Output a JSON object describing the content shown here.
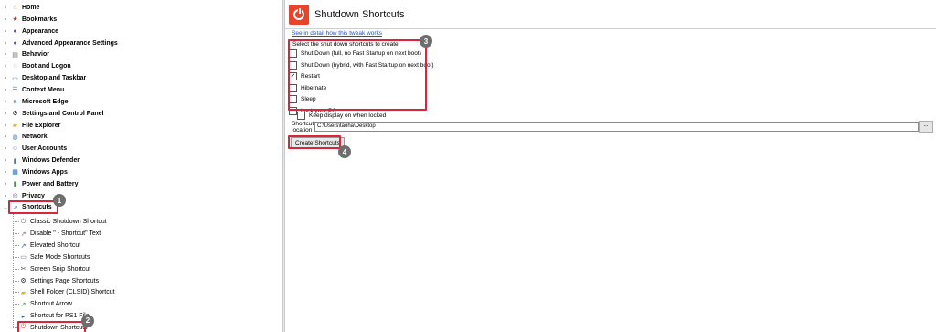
{
  "tree": {
    "categories": [
      {
        "label": "Home",
        "icon": "home-icon",
        "glyph": "⌂",
        "color": "#d8a339",
        "arrow": "›"
      },
      {
        "label": "Bookmarks",
        "icon": "bookmark-icon",
        "glyph": "★",
        "color": "#c0392b",
        "arrow": "›"
      },
      {
        "label": "Appearance",
        "icon": "palette-icon",
        "glyph": "●",
        "color": "#7b3fbf",
        "arrow": "›"
      },
      {
        "label": "Advanced Appearance Settings",
        "icon": "advanced-appearance-icon",
        "glyph": "●",
        "color": "#4a55c8",
        "arrow": "›"
      },
      {
        "label": "Behavior",
        "icon": "behavior-icon",
        "glyph": "▤",
        "color": "#6d6d6d",
        "arrow": "›"
      },
      {
        "label": "Boot and Logon",
        "icon": "boot-icon",
        "glyph": "◌",
        "color": "#555555",
        "arrow": "›"
      },
      {
        "label": "Desktop and Taskbar",
        "icon": "desktop-icon",
        "glyph": "▭",
        "color": "#3b7bd4",
        "arrow": "›"
      },
      {
        "label": "Context Menu",
        "icon": "context-menu-icon",
        "glyph": "☰",
        "color": "#5b6c8c",
        "arrow": "›"
      },
      {
        "label": "Microsoft Edge",
        "icon": "edge-icon",
        "glyph": "e",
        "color": "#1f8ec9",
        "arrow": "›"
      },
      {
        "label": "Settings and Control Panel",
        "icon": "settings-icon",
        "glyph": "⚙",
        "color": "#222222",
        "arrow": "›"
      },
      {
        "label": "File Explorer",
        "icon": "folder-icon",
        "glyph": "▰",
        "color": "#e3b23c",
        "arrow": "›"
      },
      {
        "label": "Network",
        "icon": "network-icon",
        "glyph": "◍",
        "color": "#3b6fb6",
        "arrow": "›"
      },
      {
        "label": "User Accounts",
        "icon": "user-icon",
        "glyph": "☺",
        "color": "#3a7abf",
        "arrow": "›"
      },
      {
        "label": "Windows Defender",
        "icon": "defender-icon",
        "glyph": "▮",
        "color": "#4b6ea8",
        "arrow": "›"
      },
      {
        "label": "Windows Apps",
        "icon": "apps-icon",
        "glyph": "▦",
        "color": "#2a6cc2",
        "arrow": "›"
      },
      {
        "label": "Power and Battery",
        "icon": "battery-icon",
        "glyph": "▮",
        "color": "#3c9a3c",
        "arrow": "›"
      },
      {
        "label": "Privacy",
        "icon": "privacy-icon",
        "glyph": "◎",
        "color": "#5b5b8c",
        "arrow": "›"
      },
      {
        "label": "Shortcuts",
        "icon": "shortcuts-icon",
        "glyph": "↗",
        "color": "#2a5bc0",
        "arrow": "⌄"
      }
    ],
    "shortcuts_children": [
      {
        "label": "Classic Shutdown Shortcut",
        "icon": "shutdown-icon",
        "glyph": "⏻",
        "color": "#e2472b"
      },
      {
        "label": "Disable \" - Shortcut\" Text",
        "icon": "disable-text-icon",
        "glyph": "↗",
        "color": "#6c6c6c"
      },
      {
        "label": "Elevated Shortcut",
        "icon": "elevated-icon",
        "glyph": "↗",
        "color": "#2a5bc0"
      },
      {
        "label": "Safe Mode Shortcuts",
        "icon": "safe-mode-icon",
        "glyph": "▭",
        "color": "#5f6a7a"
      },
      {
        "label": "Screen Snip Shortcut",
        "icon": "scissors-icon",
        "glyph": "✂",
        "color": "#4a4a4a"
      },
      {
        "label": "Settings Page Shortcuts",
        "icon": "gear-icon",
        "glyph": "⚙",
        "color": "#222222"
      },
      {
        "label": "Shell Folder (CLSID) Shortcut",
        "icon": "shell-folder-icon",
        "glyph": "▰",
        "color": "#e3b23c"
      },
      {
        "label": "Shortcut Arrow",
        "icon": "arrow-icon",
        "glyph": "↗",
        "color": "#3c9a3c"
      },
      {
        "label": "Shortcut for PS1 File",
        "icon": "ps1-icon",
        "glyph": "▸",
        "color": "#2b5fa8"
      },
      {
        "label": "Shutdown Shortcuts",
        "icon": "power-icon",
        "glyph": "⏻",
        "color": "#e2472b"
      }
    ]
  },
  "callouts": [
    "1",
    "2",
    "3",
    "4"
  ],
  "panel": {
    "title": "Shutdown Shortcuts",
    "link": "See in detail how this tweak works",
    "options_label": "Select the shut down shortcuts to create",
    "options": [
      {
        "label": "Shut Down (full, no Fast Startup on next boot)",
        "checked": false
      },
      {
        "label": "Shut Down (hybrid, with Fast Startup on next boot)",
        "checked": false
      },
      {
        "label": "Restart",
        "checked": true
      },
      {
        "label": "Hibernate",
        "checked": false
      },
      {
        "label": "Sleep",
        "checked": false
      },
      {
        "label": "Lock your PC",
        "checked": false
      }
    ],
    "keep_display": {
      "label": "Keep display on when locked",
      "checked": false
    },
    "location_label_1": "Shortcut",
    "location_label_2": "location",
    "location_value": "C:\\Users\\taoha\\Desktop",
    "browse_label": "...",
    "create_label": "Create Shortcuts"
  },
  "colors": {
    "callout_border": "#d9263a",
    "link": "#1a4fd0",
    "header_icon": "#e8442b"
  }
}
